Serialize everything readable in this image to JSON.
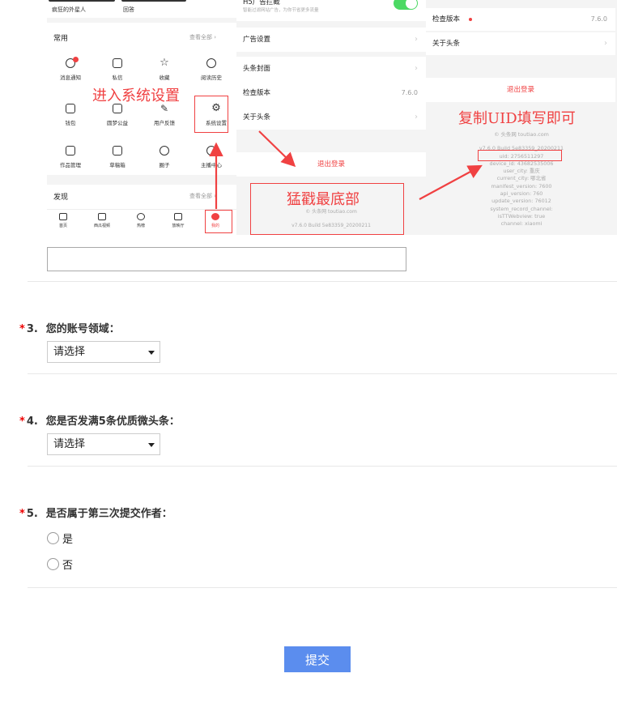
{
  "illustration": {
    "panel1": {
      "top_tabs": [
        "疯狂的外星人",
        "回答"
      ],
      "common_title": "常用",
      "see_all": "查看全部 ›",
      "grid": [
        {
          "label": "消息通知",
          "icon": "bell-icon"
        },
        {
          "label": "私信",
          "icon": "message-icon"
        },
        {
          "label": "收藏",
          "icon": "star-icon"
        },
        {
          "label": "阅读历史",
          "icon": "clock-icon"
        },
        {
          "label": "钱包",
          "icon": "wallet-icon"
        },
        {
          "label": "圆梦公益",
          "icon": "charity-icon"
        },
        {
          "label": "用户反馈",
          "icon": "feedback-icon"
        },
        {
          "label": "系统设置",
          "icon": "gear-icon"
        },
        {
          "label": "作品管理",
          "icon": "document-icon"
        },
        {
          "label": "草稿箱",
          "icon": "draft-icon"
        },
        {
          "label": "圈子",
          "icon": "circle-icon"
        },
        {
          "label": "主播中心",
          "icon": "anchor-icon"
        }
      ],
      "discover_title": "发现",
      "discover_see_all": "查看全部 ›",
      "nav": [
        {
          "label": "首页",
          "icon": "home-icon"
        },
        {
          "label": "西瓜视频",
          "icon": "play-icon"
        },
        {
          "label": "热榜",
          "icon": "hot-icon"
        },
        {
          "label": "放映厅",
          "icon": "tv-icon"
        },
        {
          "label": "我的",
          "icon": "user-icon"
        }
      ],
      "annotation": "进入系统设置"
    },
    "panel2": {
      "top_row_title": "H5广告拦截",
      "top_row_sub": "智能过滤网站广告，为你节省更多流量",
      "rows": [
        {
          "label": "广告设置",
          "value": ""
        },
        {
          "label": "头条封面",
          "value": ""
        },
        {
          "label": "检查版本",
          "value": "7.6.0"
        },
        {
          "label": "关于头条",
          "value": ""
        }
      ],
      "logout": "退出登录",
      "annotation": "猛戳最底部",
      "copyright": "© 头条网 toutiao.com",
      "build": "v7.6.0 Build 5e83359_20200211"
    },
    "panel3": {
      "rows": [
        {
          "label": "检查版本",
          "value": "7.6.0"
        },
        {
          "label": "关于头条",
          "value": ""
        }
      ],
      "logout": "退出登录",
      "annotation": "复制UID填写即可",
      "copyright": "© 头条网 toutiao.com",
      "info_lines": [
        "v7.6.0 Build 5e83359_20200211",
        "uid: 2756511297",
        "device_id: 43682535006",
        "user_city: 重庆",
        "current_city: 哪北省",
        "manifest_version: 7600",
        "api_version: 760",
        "update_version: 76012",
        "system_record_channel:",
        "isTTWebview: true",
        "channel: xiaomi"
      ]
    }
  },
  "form": {
    "textarea_value": "",
    "questions": [
      {
        "required": "*",
        "number": "3.",
        "title": "您的账号领域：",
        "type": "select",
        "selected": "请选择"
      },
      {
        "required": "*",
        "number": "4.",
        "title": "您是否发满5条优质微头条：",
        "type": "select",
        "selected": "请选择"
      },
      {
        "required": "*",
        "number": "5.",
        "title": "是否属于第三次提交作者：",
        "type": "radio",
        "options": [
          "是",
          "否"
        ]
      }
    ],
    "submit_label": "提交"
  },
  "colors": {
    "accent_red": "#f04142",
    "submit_blue": "#5b8dee",
    "toggle_green": "#4cd964"
  }
}
